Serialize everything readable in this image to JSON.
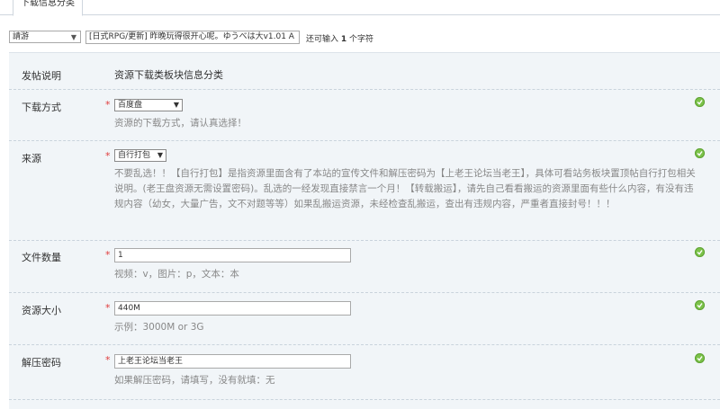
{
  "tab": {
    "label": "下载信息分类"
  },
  "top": {
    "category_select": "請游",
    "title_value": "[日式RPG/更新] 昨晚玩得很开心呢。ゆうべは大v1.01 A",
    "hint_prefix": "还可输入",
    "hint_count": "1",
    "hint_suffix": "个字符"
  },
  "header": {
    "label": "发帖说明",
    "text": "资源下载类板块信息分类"
  },
  "rows": [
    {
      "label": "下载方式",
      "select": "百度盘",
      "desc": "资源的下载方式，请认真选择！"
    },
    {
      "label": "来源",
      "select": "自行打包",
      "desc": "不要乱选！！【自行打包】是指资源里面含有了本站的宣传文件和解压密码为【上老王论坛当老王】，具体可看站务板块置顶帖自行打包相关说明。(老王盘资源无需设置密码)。乱选的一经发现直接禁言一个月！【转载搬运】，请先自己看看搬运的资源里面有些什么内容，有没有违规内容（幼女，大量广告，文不对题等等）如果乱搬运资源，未经检查乱搬运，查出有违规内容，严重者直接封号！！！"
    },
    {
      "label": "文件数量",
      "value": "1",
      "desc": "视频：v，图片：p，文本：本"
    },
    {
      "label": "资源大小",
      "value": "440M",
      "desc": "示例：3000M or 3G"
    },
    {
      "label": "解压密码",
      "value": "上老王论坛当老王",
      "desc": "如果解压密码，请填写，没有就填：无"
    }
  ],
  "required_mark": "*",
  "colors": {
    "ok": "#7cc24a",
    "required": "#e03c3c",
    "panel": "#f1f5f8"
  }
}
